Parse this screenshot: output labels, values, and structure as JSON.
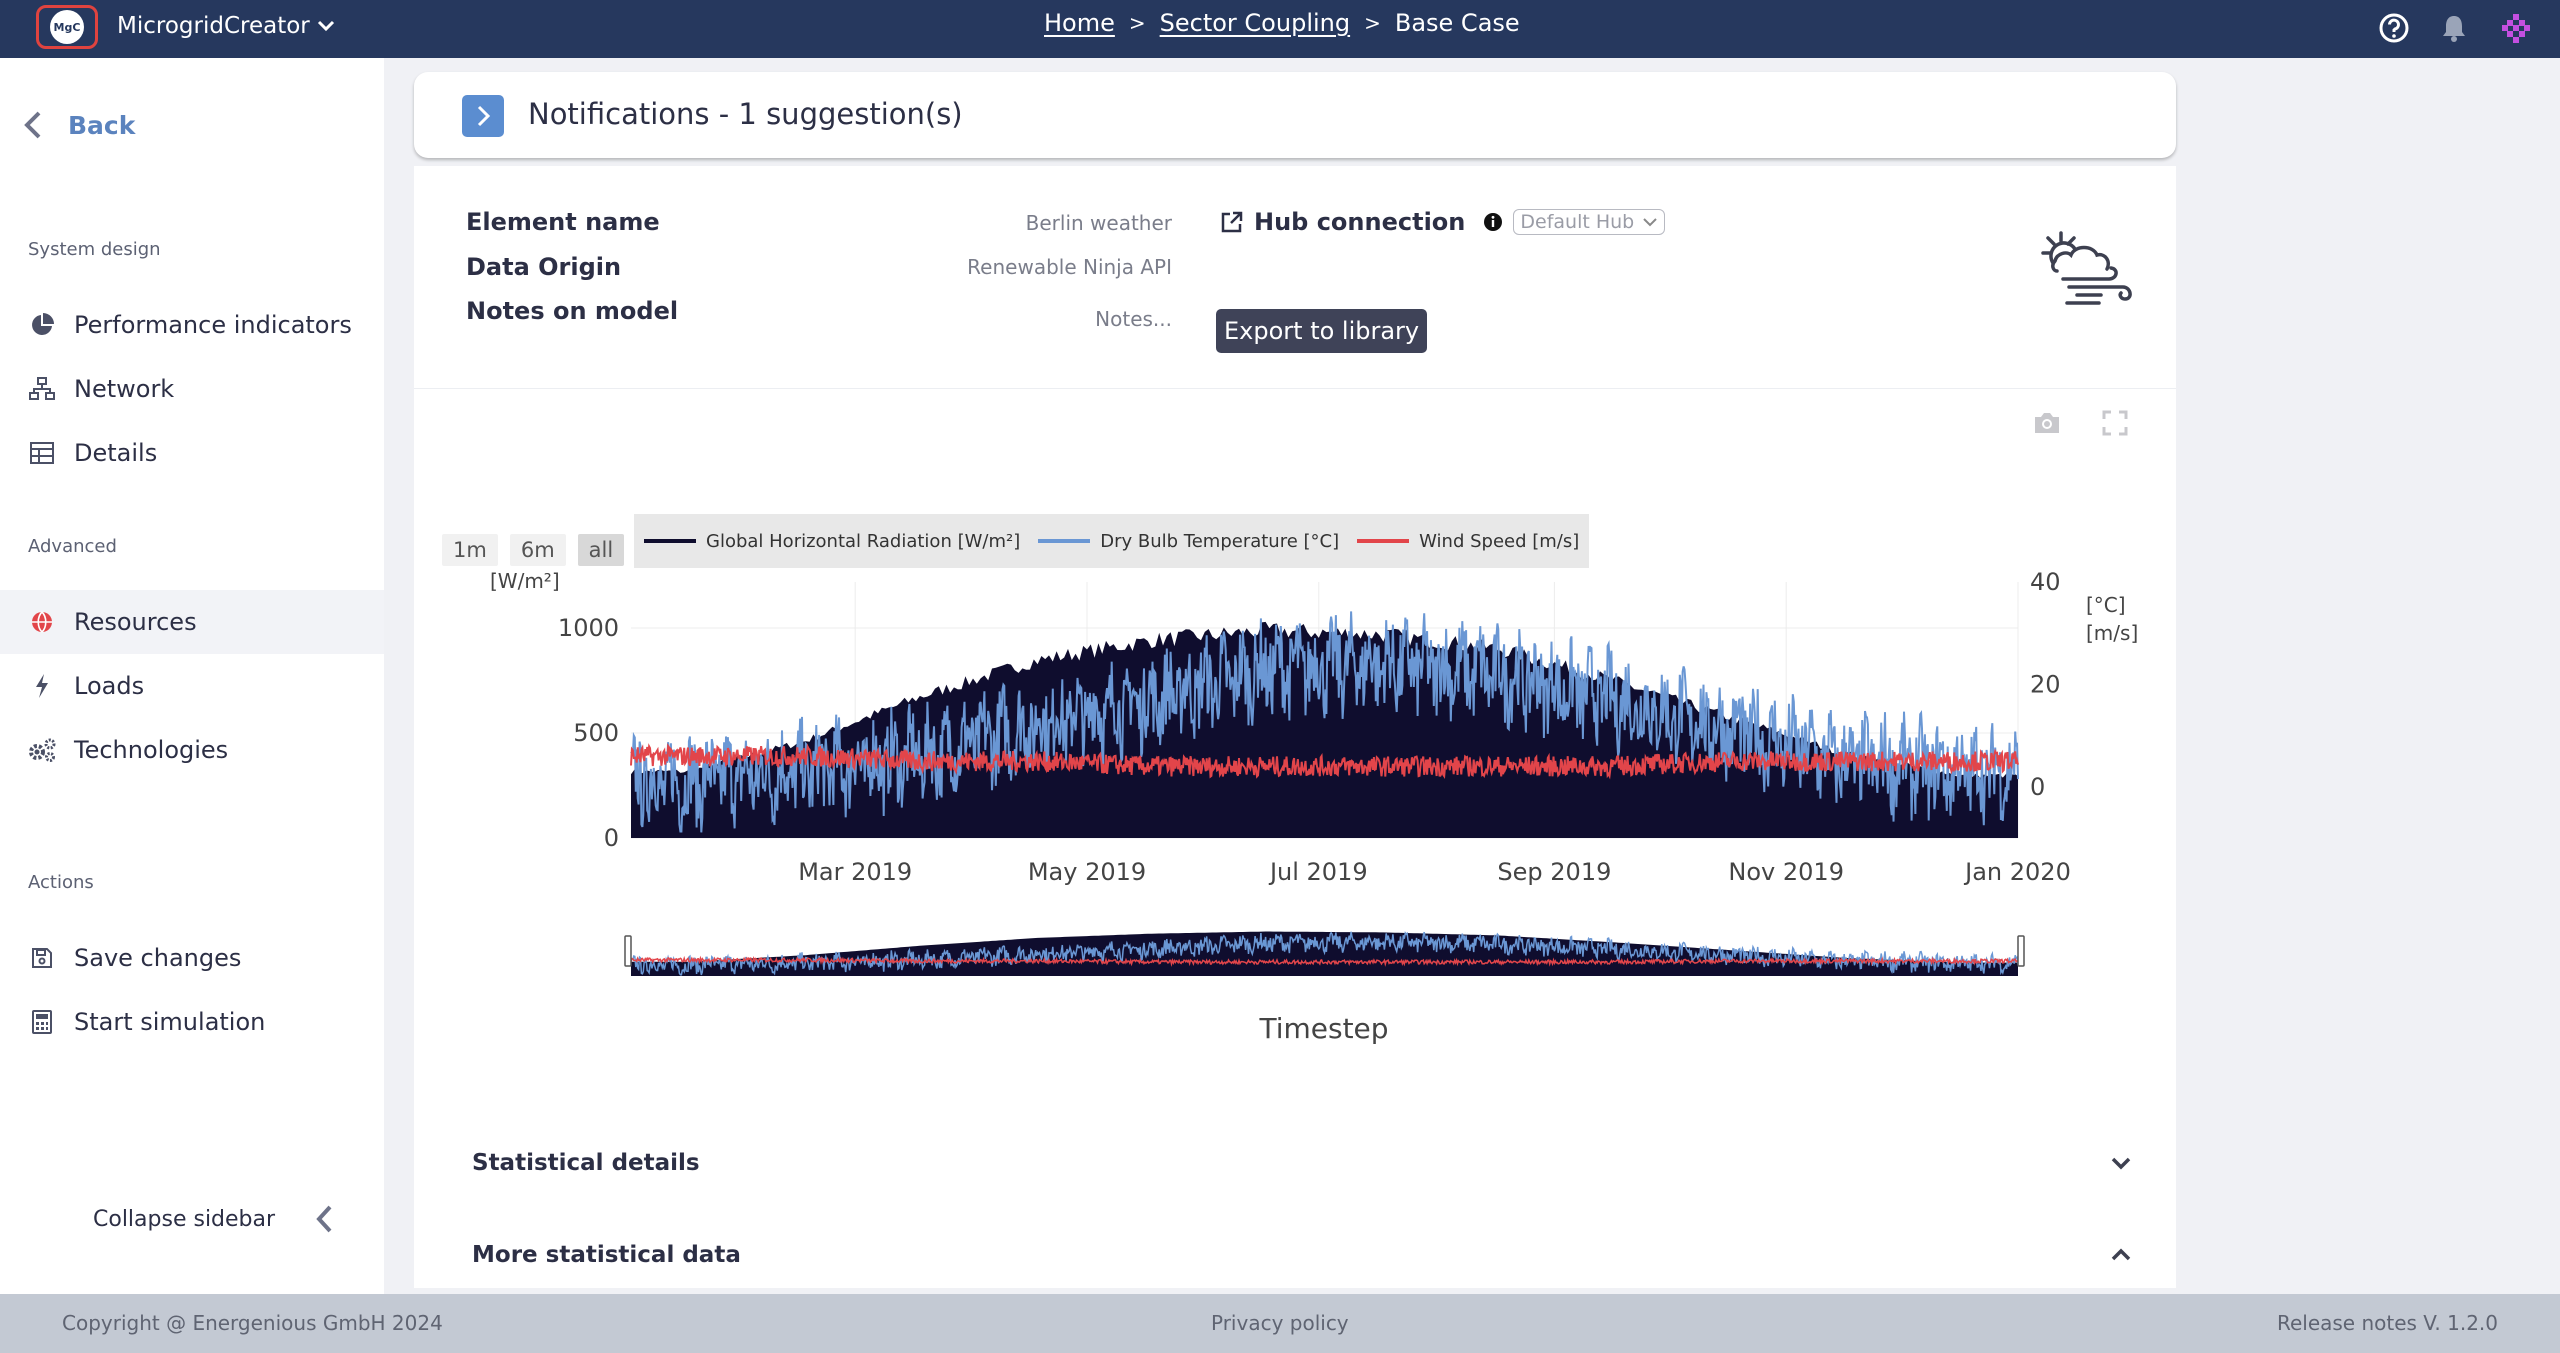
{
  "header": {
    "logo_text": "MgC",
    "app_name": "MicrogridCreator",
    "breadcrumb": [
      {
        "label": "Home",
        "link": true
      },
      {
        "label": "Sector Coupling",
        "link": true
      },
      {
        "label": "Base Case",
        "link": false
      }
    ],
    "icons": [
      "help-icon",
      "bell-icon",
      "user-avatar-icon"
    ]
  },
  "sidebar": {
    "back_label": "Back",
    "sections": [
      {
        "title": "System design",
        "items": [
          {
            "label": "Performance indicators",
            "icon": "pie-chart-icon"
          },
          {
            "label": "Network",
            "icon": "network-icon"
          },
          {
            "label": "Details",
            "icon": "table-icon"
          }
        ]
      },
      {
        "title": "Advanced",
        "items": [
          {
            "label": "Resources",
            "icon": "globe-icon",
            "active": true
          },
          {
            "label": "Loads",
            "icon": "bolt-icon"
          },
          {
            "label": "Technologies",
            "icon": "gears-icon"
          }
        ]
      },
      {
        "title": "Actions",
        "items": [
          {
            "label": "Save changes",
            "icon": "save-icon"
          },
          {
            "label": "Start simulation",
            "icon": "calculator-icon"
          }
        ]
      }
    ],
    "collapse_label": "Collapse sidebar"
  },
  "notifications": {
    "text": "Notifications - 1 suggestion(s)"
  },
  "element": {
    "labels": {
      "name": "Element name",
      "origin": "Data Origin",
      "notes": "Notes on model"
    },
    "name_value": "Berlin weather",
    "origin_value": "Renewable Ninja API",
    "notes_placeholder": "Notes...",
    "hub_label": "Hub connection",
    "hub_value": "Default Hub",
    "export_label": "Export to library",
    "icon": "weather-icon"
  },
  "chart_controls": {
    "range_buttons": [
      "1m",
      "6m",
      "all"
    ],
    "active_range": "all",
    "tools": [
      "camera-icon",
      "fullscreen-icon"
    ]
  },
  "chart_data": {
    "type": "area",
    "title": "",
    "xlabel": "Timestep",
    "ylabel_left": "[W/m²]",
    "ylabel_right_1": "[°C]",
    "ylabel_right_2": "[m/s]",
    "x_range": [
      "2019-01-01",
      "2020-01-01"
    ],
    "x_ticks": [
      "Mar 2019",
      "May 2019",
      "Jul 2019",
      "Sep 2019",
      "Nov 2019",
      "Jan 2020"
    ],
    "x_tick_months": [
      2,
      4,
      6,
      8,
      10,
      12
    ],
    "y_left_ticks": [
      "0",
      "500",
      "1000"
    ],
    "y_left_range": [
      0,
      1000
    ],
    "y_right_ticks": [
      "0",
      "20",
      "40"
    ],
    "y_right_range": [
      -10,
      40
    ],
    "legend_placement": "top-left",
    "grid": true,
    "series": [
      {
        "name": "Global Horizontal Radiation [W/m²]",
        "color": "#0f0d2e",
        "axis": "left",
        "monthly_peak": [
          330,
          480,
          700,
          880,
          980,
          1030,
          1010,
          940,
          780,
          600,
          420,
          310
        ]
      },
      {
        "name": "Dry Bulb Temperature [°C]",
        "color": "#6a97d4",
        "axis": "right",
        "monthly_mean": [
          1,
          3,
          6,
          12,
          17,
          23,
          24,
          22,
          17,
          11,
          5,
          3
        ]
      },
      {
        "name": "Wind Speed [m/s]",
        "color": "#e2454a",
        "axis": "right",
        "monthly_mean": [
          6,
          6,
          5,
          5,
          4,
          4,
          4,
          4,
          4,
          5,
          5,
          5
        ]
      }
    ]
  },
  "accordions": [
    {
      "label": "Statistical details",
      "state": "collapsed"
    },
    {
      "label": "More statistical data",
      "state": "expanded"
    }
  ],
  "footer": {
    "copyright": "Copyright @ Energenious GmbH 2024",
    "privacy": "Privacy policy",
    "release": "Release notes V. 1.2.0"
  }
}
